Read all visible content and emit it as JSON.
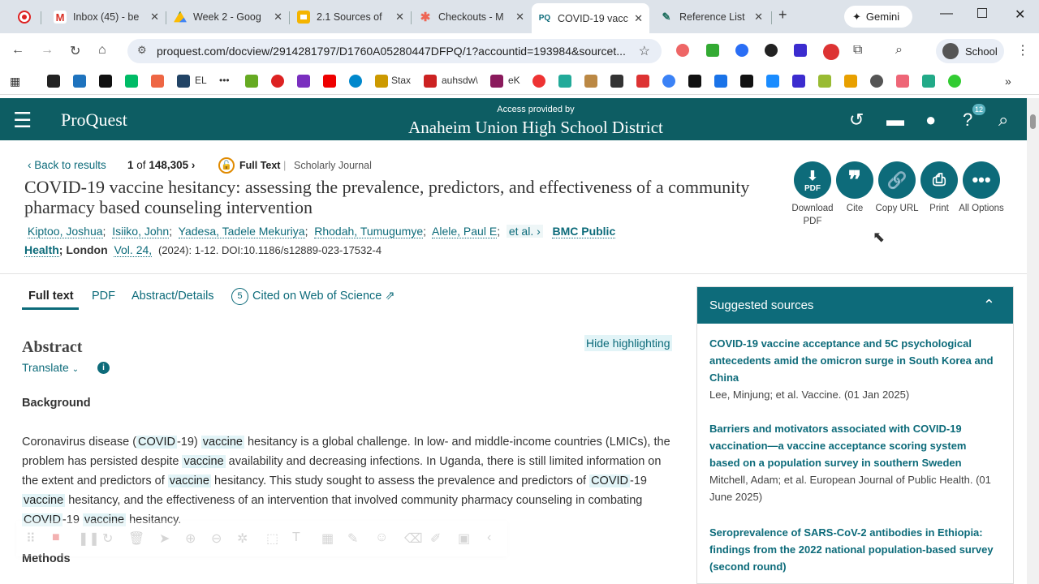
{
  "tabs": [
    {
      "title": "",
      "icon": "record-icon",
      "color": "#d22"
    },
    {
      "title": "Inbox (45) - be",
      "icon": "gmail-icon",
      "color": "#d93025"
    },
    {
      "title": "Week 2 - Goog",
      "icon": "drive-icon",
      "color": "#188038"
    },
    {
      "title": "2.1 Sources of",
      "icon": "slides-icon",
      "color": "#f4b400"
    },
    {
      "title": "Checkouts - M",
      "icon": "checkouts-icon",
      "color": "#e65"
    },
    {
      "title": "COVID-19 vacc",
      "icon": "proquest-icon",
      "color": "#0d6b7a"
    },
    {
      "title": "Reference List",
      "icon": "reference-icon",
      "color": "#1e8e6e"
    }
  ],
  "gemini_label": "Gemini",
  "url": "proquest.com/docview/2914281797/D1760A05280447DFPQ/1?accountid=193984&sourcet...",
  "profile_label": "School",
  "bookmarks": [
    "EL",
    "Stax",
    "auhsdw\\",
    "eK"
  ],
  "header": {
    "logo": "ProQuest",
    "access_by": "Access provided by",
    "district": "Anaheim Union High School District",
    "help_badge": "12"
  },
  "results": {
    "back": "Back to results",
    "position": "1",
    "of_label": "of",
    "total": "148,305",
    "full_text_badge": "Full Text",
    "doc_type": "Scholarly Journal"
  },
  "article": {
    "title": "COVID-19 vaccine hesitancy: assessing the prevalence, predictors, and effectiveness of a community pharmacy based counseling intervention",
    "authors": [
      "Kiptoo, Joshua",
      "Isiiko, John",
      "Yadesa, Tadele Mekuriya",
      "Rhodah, Tumugumye",
      "Alele, Paul E"
    ],
    "et_al": "et al.",
    "journal_a": "BMC Public",
    "journal_b": "Health",
    "place": "; London",
    "volume": "Vol. 24,",
    "citation": "(2024): 1-12. DOI:10.1186/s12889-023-17532-4"
  },
  "actions": [
    {
      "label": "Download PDF",
      "icon": "download-pdf-icon"
    },
    {
      "label": "Cite",
      "icon": "cite-icon"
    },
    {
      "label": "Copy URL",
      "icon": "link-icon"
    },
    {
      "label": "Print",
      "icon": "print-icon"
    },
    {
      "label": "All Options",
      "icon": "more-icon"
    }
  ],
  "doc_tabs": {
    "full_text": "Full text",
    "pdf": "PDF",
    "abstract": "Abstract/Details",
    "cited_count": "5",
    "cited": "Cited on Web of Science"
  },
  "abstract": {
    "heading": "Abstract",
    "translate": "Translate",
    "hide_highlighting": "Hide highlighting",
    "background_heading": "Background",
    "methods_heading": "Methods",
    "paragraph": [
      {
        "t": "Coronavirus disease (",
        "h": false
      },
      {
        "t": "COVID",
        "h": true
      },
      {
        "t": "-19) ",
        "h": false
      },
      {
        "t": "vaccine",
        "h": true
      },
      {
        "t": " hesitancy is a global challenge. In low- and middle-income countries (LMICs), the problem has persisted despite ",
        "h": false
      },
      {
        "t": "vaccine",
        "h": true
      },
      {
        "t": " availability and decreasing infections. In Uganda, there is still limited information on the extent and predictors of ",
        "h": false
      },
      {
        "t": "vaccine",
        "h": true
      },
      {
        "t": " hesitancy. This study sought to assess the prevalence and predictors of ",
        "h": false
      },
      {
        "t": "COVID",
        "h": true
      },
      {
        "t": "-19 ",
        "h": false
      },
      {
        "t": "vaccine",
        "h": true
      },
      {
        "t": " hesitancy, and the effectiveness of an intervention that involved community pharmacy counseling in combating ",
        "h": false
      },
      {
        "t": "COVID",
        "h": true
      },
      {
        "t": "-19 ",
        "h": false
      },
      {
        "t": "vaccine",
        "h": true
      },
      {
        "t": " hesitancy.",
        "h": false
      }
    ]
  },
  "suggested": {
    "heading": "Suggested sources",
    "items": [
      {
        "title": "COVID-19 vaccine acceptance and 5C psychological antecedents amid the omicron surge in South Korea and China",
        "meta": "Lee, Minjung; et al. Vaccine. (01 Jan 2025)"
      },
      {
        "title": "Barriers and motivators associated with COVID-19 vaccination—a vaccine acceptance scoring system based on a population survey in southern Sweden",
        "meta": "Mitchell, Adam; et al. European Journal of Public Health. (01 June 2025)"
      },
      {
        "title": "Seroprevalence of SARS-CoV-2 antibodies in Ethiopia: findings from the 2022 national population-based survey (second round)",
        "meta": ""
      }
    ]
  }
}
